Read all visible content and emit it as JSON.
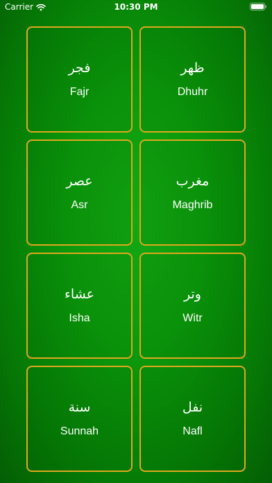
{
  "status_bar": {
    "carrier": "Carrier",
    "time": "10:30 PM",
    "wifi_icon": "wifi-icon",
    "battery_icon": "battery-icon"
  },
  "colors": {
    "background": "#0a9a0a",
    "tile_border": "#e0a81e",
    "text": "#ffffff"
  },
  "prayers": [
    {
      "arabic": "فجر",
      "name": "Fajr"
    },
    {
      "arabic": "ظهر",
      "name": "Dhuhr"
    },
    {
      "arabic": "عصر",
      "name": "Asr"
    },
    {
      "arabic": "مغرب",
      "name": "Maghrib"
    },
    {
      "arabic": "عشاء",
      "name": "Isha"
    },
    {
      "arabic": "وتر",
      "name": "Witr"
    },
    {
      "arabic": "سنة",
      "name": "Sunnah"
    },
    {
      "arabic": "نفل",
      "name": "Nafl"
    }
  ]
}
